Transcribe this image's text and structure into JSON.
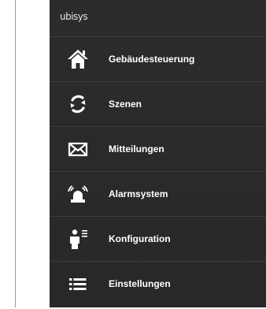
{
  "app": {
    "brand": "ubisys"
  },
  "menu": {
    "items": [
      {
        "label": "Gebäudesteuerung",
        "icon": "house-icon"
      },
      {
        "label": "Szenen",
        "icon": "refresh-icon"
      },
      {
        "label": "Mitteilungen",
        "icon": "envelope-icon"
      },
      {
        "label": "Alarmsystem",
        "icon": "alarm-siren-icon"
      },
      {
        "label": "Konfiguration",
        "icon": "user-config-icon"
      },
      {
        "label": "Einstellungen",
        "icon": "list-icon"
      }
    ]
  },
  "colors": {
    "panel_bg": "#2a2a2a",
    "divider": "#3d3d3d",
    "text": "#ffffff"
  }
}
